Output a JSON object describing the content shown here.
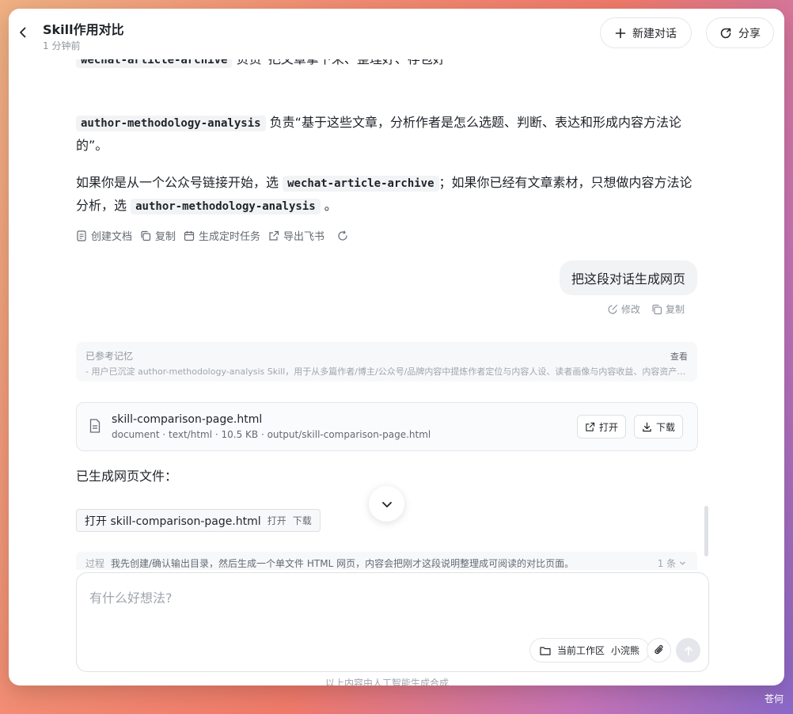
{
  "header": {
    "title": "Skill作用对比",
    "subtitle": "1 分钟前",
    "new_chat": "新建对话",
    "share": "分享"
  },
  "message": {
    "line0_code": "wechat-article-archive",
    "line0_text": "负责“把文章拿下来、整理好、存包好”",
    "p1_code": "author-methodology-analysis",
    "p1_text": "负责“基于这些文章，分析作者是怎么选题、判断、表达和形成内容方法论的”。",
    "p2_a": "如果你是从一个公众号链接开始，选",
    "p2_code1": "wechat-article-archive",
    "p2_b": "；如果你已经有文章素材，只想做内容方法论分析，选",
    "p2_code2": "author-methodology-analysis",
    "p2_c": "。"
  },
  "actions": {
    "create_doc": "创建文档",
    "copy": "复制",
    "schedule": "生成定时任务",
    "export": "导出飞书"
  },
  "user": {
    "message": "把这段对话生成网页",
    "edit": "修改",
    "copy": "复制"
  },
  "memory": {
    "title": "已参考记忆",
    "view": "查看",
    "desc": "- 用户已沉淀 author-methodology-analysis Skill，用于从多篇作者/博主/公众号/品牌内容中提炼作者定位与内容人设、读者画像与内容收益、内容资产地..."
  },
  "file": {
    "name": "skill-comparison-page.html",
    "meta": "document · text/html · 10.5 KB · output/skill-comparison-page.html",
    "open": "打开",
    "download": "下载"
  },
  "generated": {
    "text": "已生成网页文件：",
    "inline_name": "打开 skill-comparison-page.html",
    "inline_open": "打开",
    "inline_download": "下载"
  },
  "process": {
    "label": "过程",
    "text": "我先创建/确认输出目录，然后生成一个单文件 HTML 网页，内容会把刚才这段说明整理成可阅读的对比页面。",
    "count": "1 条"
  },
  "composer": {
    "placeholder": "有什么好想法?",
    "workspace": "当前工作区",
    "workspace_name": "小浣熊"
  },
  "footer": {
    "note": "以上内容由人工智能生成合成"
  },
  "corner": {
    "text": "苍何"
  }
}
